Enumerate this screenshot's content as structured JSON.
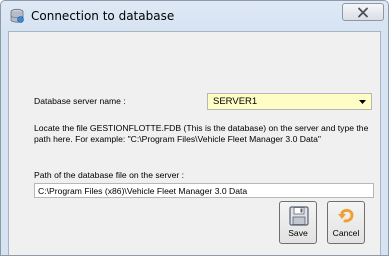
{
  "window": {
    "title": "Connection to database"
  },
  "server": {
    "label": "Database server name :",
    "value": "SERVER1"
  },
  "instructions": "Locate the file GESTIONFLOTTE.FDB (This is the database) on the server and type the path here. For example: \"C:\\Program Files\\Vehicle Fleet Manager 3.0 Data\"",
  "path": {
    "label": "Path of the database file on the server :",
    "value": "C:\\Program Files (x86)\\Vehicle Fleet Manager 3.0 Data"
  },
  "buttons": {
    "save_label": "Save",
    "cancel_label": "Cancel"
  },
  "icons": {
    "title": "database-connection-icon",
    "close": "close-icon",
    "dropdown": "chevron-down-icon",
    "save": "floppy-disk-icon",
    "cancel": "undo-arrow-icon"
  },
  "colors": {
    "combo_background": "#fffdc6",
    "cancel_icon": "#f0a030"
  }
}
